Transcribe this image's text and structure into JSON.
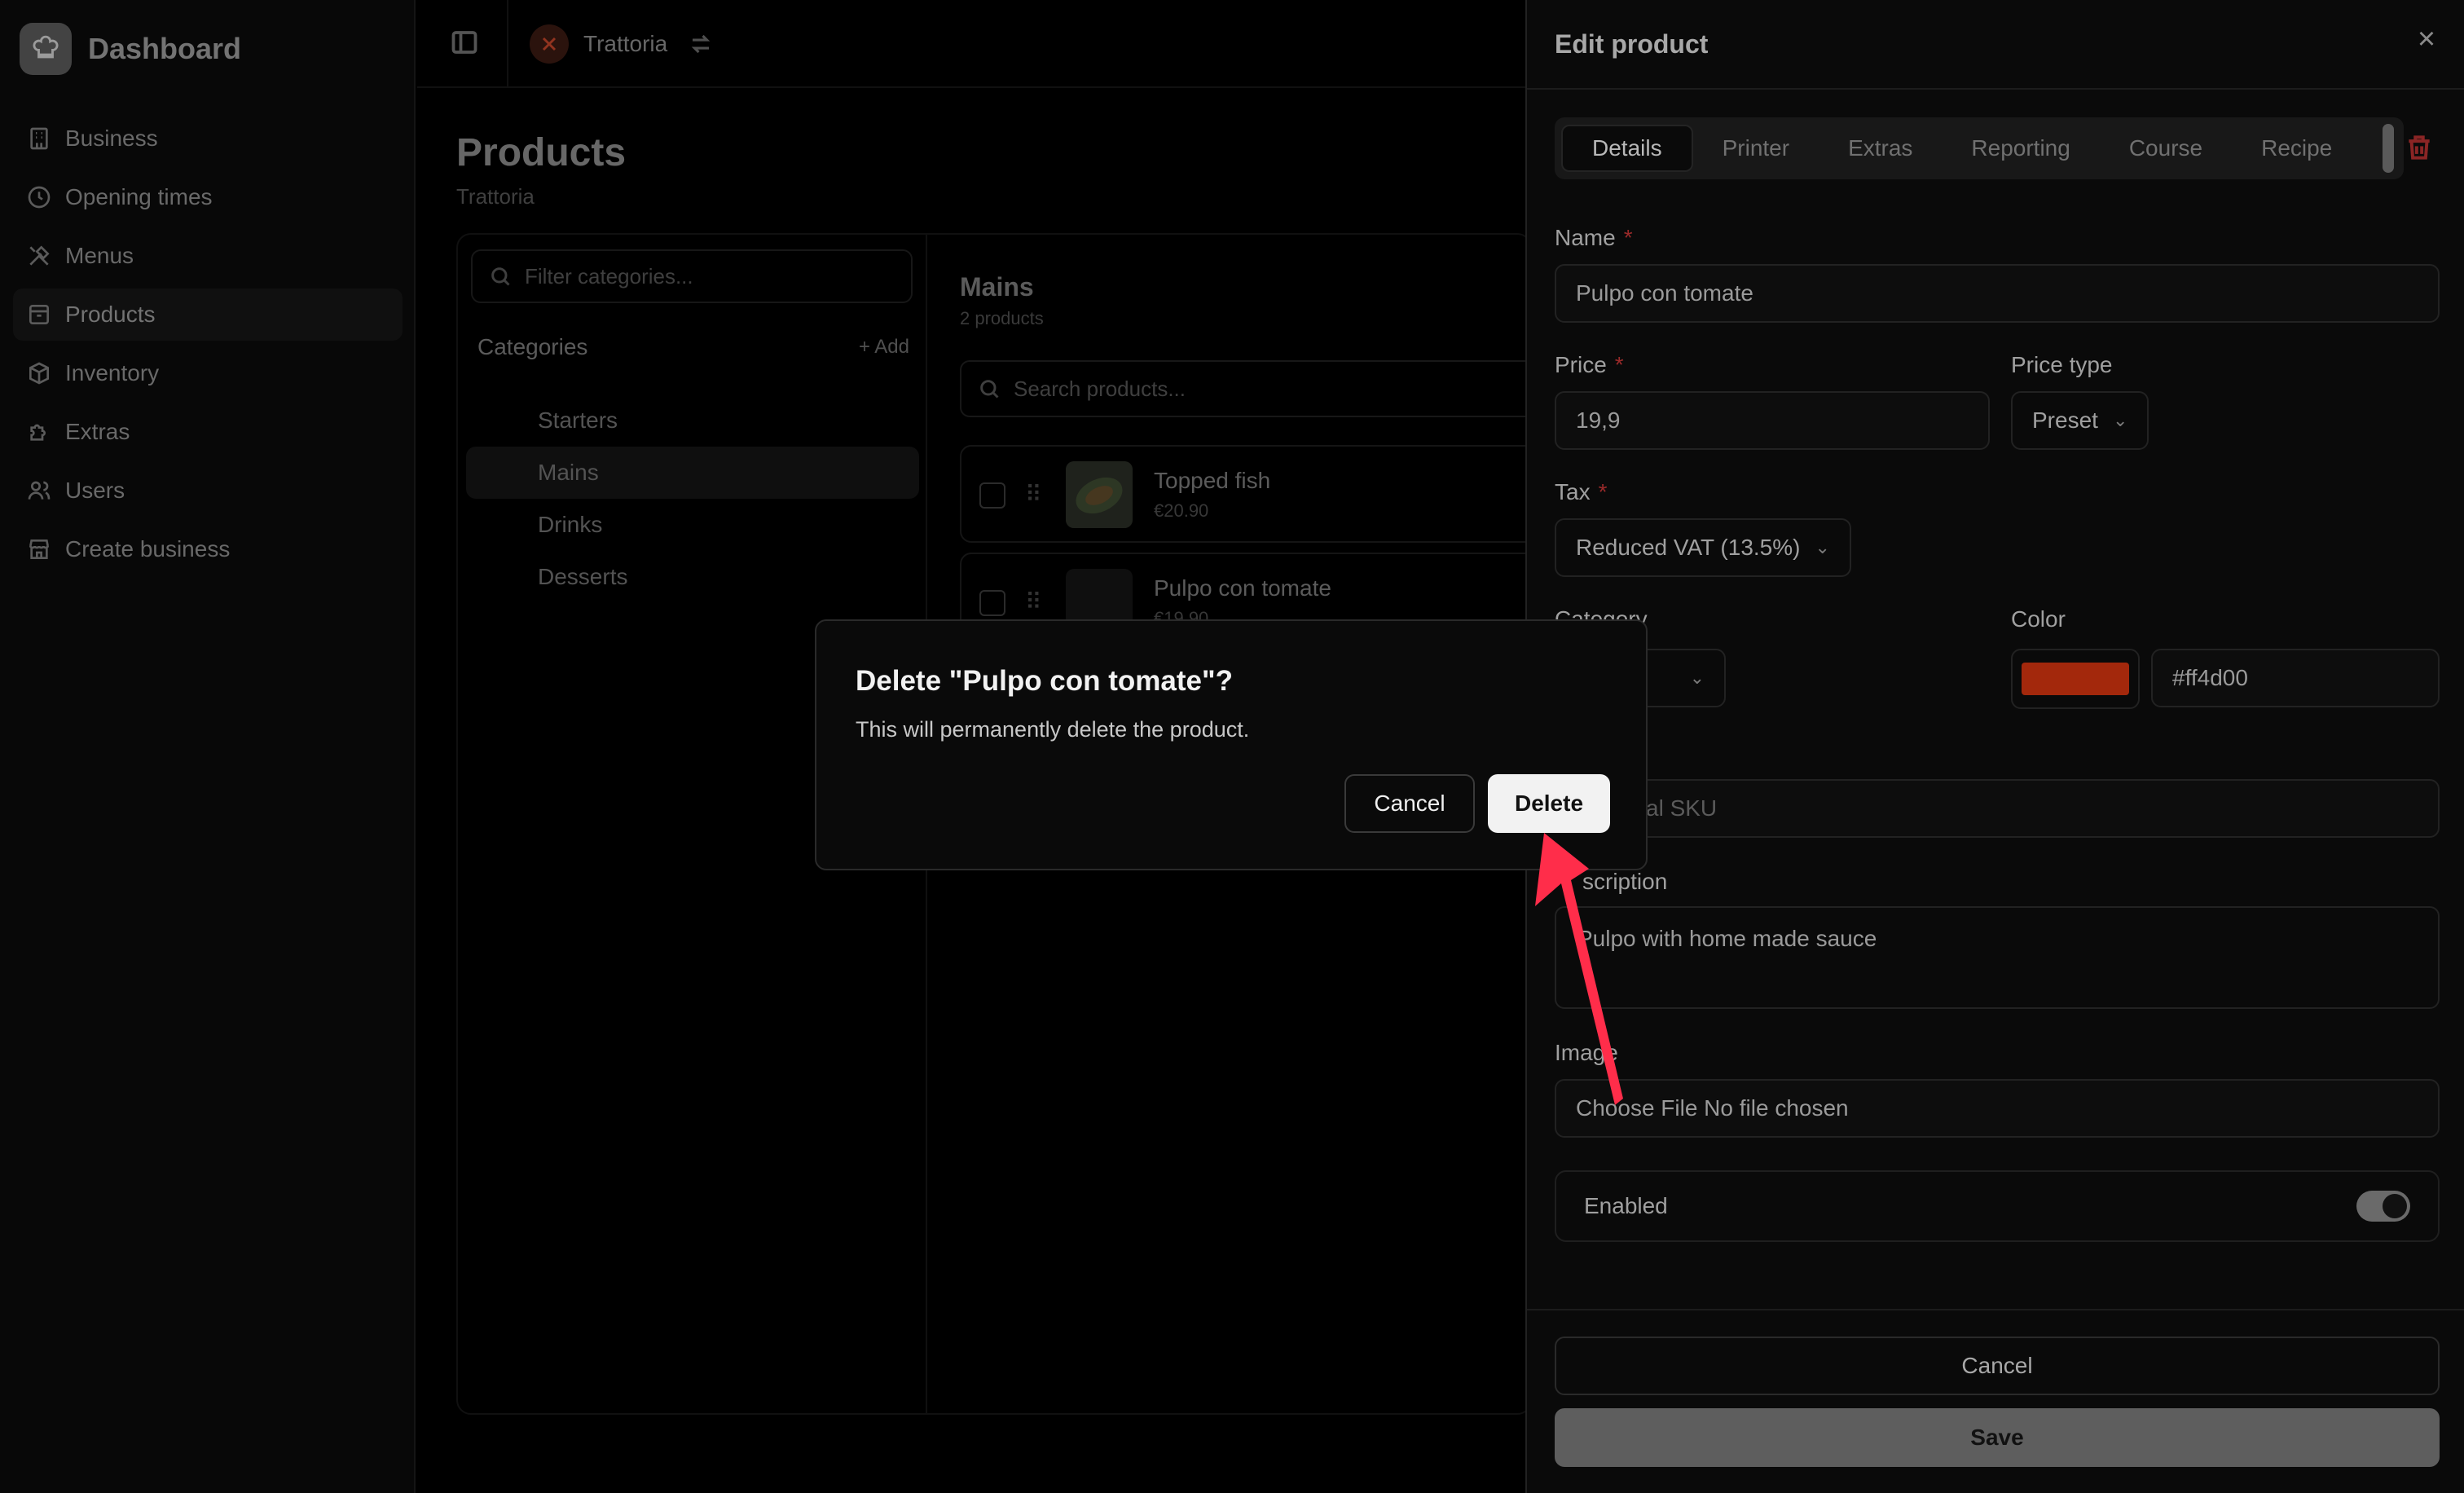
{
  "sidebar": {
    "brand": "Dashboard",
    "items": [
      {
        "label": "Business",
        "icon": "building-icon"
      },
      {
        "label": "Opening times",
        "icon": "clock-icon"
      },
      {
        "label": "Menus",
        "icon": "utensils-icon"
      },
      {
        "label": "Products",
        "icon": "package-icon",
        "active": true
      },
      {
        "label": "Inventory",
        "icon": "box-icon"
      },
      {
        "label": "Extras",
        "icon": "puzzle-icon"
      },
      {
        "label": "Users",
        "icon": "users-icon"
      },
      {
        "label": "Create business",
        "icon": "store-icon"
      }
    ]
  },
  "topbar": {
    "business": "Trattoria"
  },
  "main": {
    "title": "Products",
    "subtitle": "Trattoria",
    "filter_placeholder": "Filter categories...",
    "categories_title": "Categories",
    "add_label": "+ Add",
    "categories": [
      "Starters",
      "Mains",
      "Drinks",
      "Desserts"
    ],
    "active_category": "Mains",
    "products_title": "Mains",
    "products_count": "2 products",
    "search_placeholder": "Search products...",
    "products": [
      {
        "name": "Topped fish",
        "price": "€20.90"
      },
      {
        "name": "Pulpo con tomate",
        "price": "€19.90"
      }
    ]
  },
  "drawer": {
    "title": "Edit product",
    "tabs": [
      "Details",
      "Printer",
      "Extras",
      "Reporting",
      "Course",
      "Recipe"
    ],
    "active_tab": "Details",
    "name_label": "Name",
    "name_value": "Pulpo con tomate",
    "price_label": "Price",
    "price_value": "19,9",
    "price_type_label": "Price type",
    "price_type_value": "Preset",
    "tax_label": "Tax",
    "tax_value": "Reduced VAT (13.5%)",
    "category_label_partial": "Category",
    "color_label": "Color",
    "color_value": "#ff4d00",
    "color_swatch": "#a3280c",
    "sku_placeholder_partial": "al SKU",
    "description_label_partial": "scription",
    "description_value": "Pulpo with home made sauce",
    "image_label": "Image",
    "image_value": "Choose File No file chosen",
    "enabled_label": "Enabled",
    "enabled": true,
    "cancel_label": "Cancel",
    "save_label": "Save"
  },
  "modal": {
    "title": "Delete \"Pulpo con tomate\"?",
    "description": "This will permanently delete the product.",
    "cancel_label": "Cancel",
    "delete_label": "Delete"
  },
  "annotation": {
    "arrow_color": "#ff2d4a"
  }
}
